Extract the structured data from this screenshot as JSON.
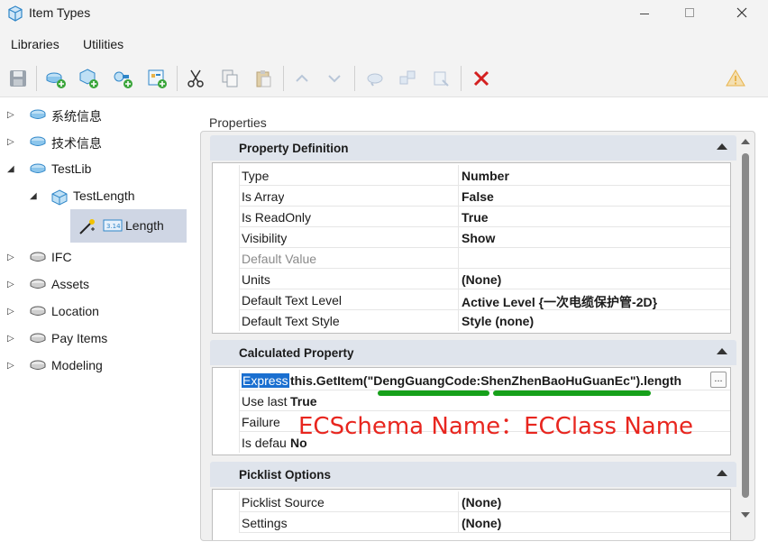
{
  "window": {
    "title": "Item Types",
    "icons": {
      "app": "item-types-cube-icon",
      "minimize": "minimize-icon",
      "maximize": "maximize-icon",
      "close": "close-icon"
    }
  },
  "menu": [
    "Libraries",
    "Utilities"
  ],
  "toolbar": {
    "icons": [
      "save-icon",
      "add-library-icon",
      "add-item-type-icon",
      "add-property-icon",
      "import-icon",
      "cut-icon",
      "copy-icon",
      "paste-icon",
      "move-up-icon",
      "move-down-icon",
      "attach-icon",
      "detach-icon",
      "relate-icon",
      "delete-icon",
      "warning-icon"
    ],
    "colors": {
      "delete": "#d42020",
      "add": "#3aa53a",
      "disabled": "#b8c6d8",
      "warning": "#e9b34a"
    }
  },
  "tree": {
    "items": [
      {
        "label": "系统信息",
        "expander": "collapsed",
        "icon": "library-icon"
      },
      {
        "label": "技术信息",
        "expander": "collapsed",
        "icon": "library-icon"
      },
      {
        "label": "TestLib",
        "expander": "expanded",
        "icon": "library-icon"
      },
      {
        "label": "TestLength",
        "expander": "expanded",
        "icon": "item-type-icon"
      },
      {
        "label": "Length",
        "expander": "none",
        "icon": "property-icon",
        "selected": true
      },
      {
        "label": "IFC",
        "expander": "collapsed",
        "icon": "library-icon"
      },
      {
        "label": "Assets",
        "expander": "collapsed",
        "icon": "library-icon"
      },
      {
        "label": "Location",
        "expander": "collapsed",
        "icon": "library-icon"
      },
      {
        "label": "Pay Items",
        "expander": "collapsed",
        "icon": "library-icon"
      },
      {
        "label": "Modeling",
        "expander": "collapsed",
        "icon": "library-icon"
      }
    ]
  },
  "properties": {
    "title": "Properties",
    "definition": {
      "header": "Property Definition",
      "rows": [
        {
          "name": "Type",
          "value": "Number"
        },
        {
          "name": "Is Array",
          "value": "False"
        },
        {
          "name": "Is ReadOnly",
          "value": "True"
        },
        {
          "name": "Visibility",
          "value": "Show"
        },
        {
          "name": "Default Value",
          "value": ""
        },
        {
          "name": "Units",
          "value": "(None)"
        },
        {
          "name": "Default Text Level",
          "value": "Active Level {一次电缆保护管-2D}"
        },
        {
          "name": "Default Text Style",
          "value": "Style (none)"
        }
      ]
    },
    "calculated": {
      "header": "Calculated Property",
      "rows": [
        {
          "name": "Express",
          "value": "this.GetItem(\"DengGuangCode:ShenZhenBaoHuGuanEc\").length",
          "button": "..."
        },
        {
          "name": "Use last",
          "value": "True"
        },
        {
          "name": "Failure",
          "value": ""
        },
        {
          "name": "Is defau",
          "value": "No"
        }
      ]
    },
    "picklist": {
      "header": "Picklist Options",
      "rows": [
        {
          "name": "Picklist Source",
          "value": "(None)"
        },
        {
          "name": "Settings",
          "value": "(None)"
        }
      ]
    }
  },
  "annotation": {
    "text": "ECSchema Name：ECClass Name",
    "color": "#e8261f",
    "underline_color": "#16a01a"
  }
}
